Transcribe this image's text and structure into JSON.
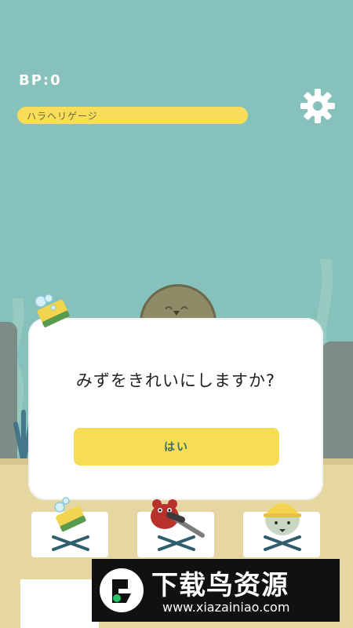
{
  "hud": {
    "bp_text": "BP:0",
    "hunger_label": "ハラヘリゲージ"
  },
  "settings": {
    "icon": "gear-icon"
  },
  "dialog": {
    "message": "みずをきれいにしますか?",
    "yes_label": "はい"
  },
  "trays": [
    {
      "icon": "sponge-icon"
    },
    {
      "icon": "crab-tongs-icon"
    },
    {
      "icon": "fish-hardhat-icon"
    }
  ],
  "watermark": {
    "title": "下载鸟资源",
    "url": "www.xiazainiao.com"
  },
  "colors": {
    "water": "#86c1bb",
    "sand": "#e6d7a2",
    "accent_yellow": "#f7dc56",
    "button_text": "#3a6e6c"
  }
}
